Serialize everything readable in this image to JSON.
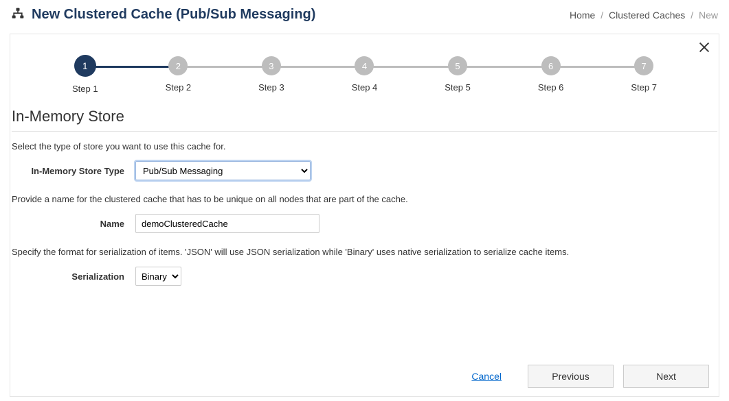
{
  "header": {
    "title": "New Clustered Cache (Pub/Sub Messaging)",
    "breadcrumb": {
      "home": "Home",
      "clustered": "Clustered Caches",
      "current": "New"
    }
  },
  "stepper": {
    "steps": [
      {
        "num": "1",
        "label": "Step 1"
      },
      {
        "num": "2",
        "label": "Step 2"
      },
      {
        "num": "3",
        "label": "Step 3"
      },
      {
        "num": "4",
        "label": "Step 4"
      },
      {
        "num": "5",
        "label": "Step 5"
      },
      {
        "num": "6",
        "label": "Step 6"
      },
      {
        "num": "7",
        "label": "Step 7"
      }
    ],
    "active_index": 0
  },
  "section": {
    "title": "In-Memory Store",
    "desc1": "Select the type of store you want to use this cache for.",
    "storeType": {
      "label": "In-Memory Store Type",
      "value": "Pub/Sub Messaging",
      "options": [
        "Pub/Sub Messaging"
      ]
    },
    "desc2": "Provide a name for the clustered cache that has to be unique on all nodes that are part of the cache.",
    "name": {
      "label": "Name",
      "value": "demoClusteredCache"
    },
    "desc3": "Specify the format for serialization of items. 'JSON' will use JSON serialization while 'Binary' uses native serialization to serialize cache items.",
    "serialization": {
      "label": "Serialization",
      "value": "Binary",
      "options": [
        "Binary"
      ]
    }
  },
  "footer": {
    "cancel": "Cancel",
    "previous": "Previous",
    "next": "Next"
  }
}
